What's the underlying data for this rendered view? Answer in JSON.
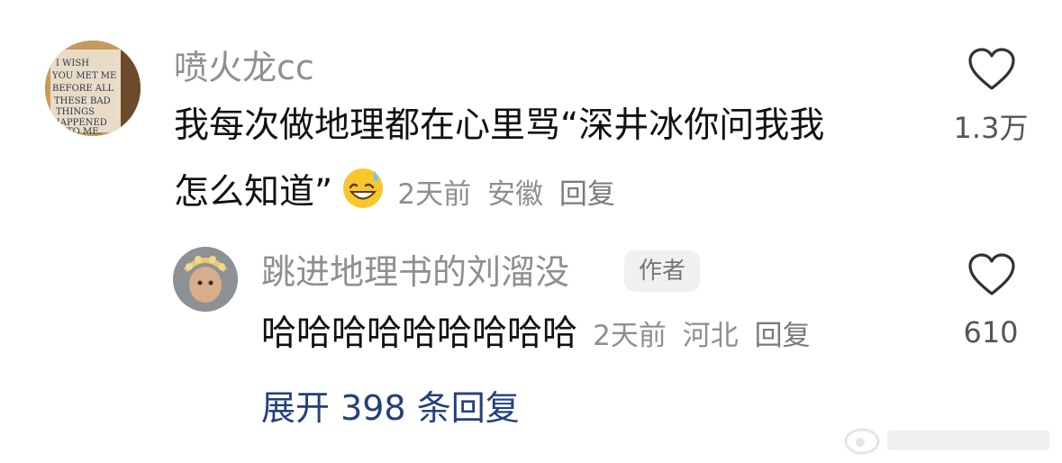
{
  "comment": {
    "username": "喷火龙cc",
    "avatar_text": "I WISH YOU MET ME BEFORE ALL THESE BAD THINGS HAPPENED TO ME.",
    "text_line1": "我每次做地理都在心里骂“深井冰你问我我",
    "text_line2": "怎么知道”",
    "emoji": "sweat-smile-emoji",
    "time": "2天前",
    "location": "安徽",
    "reply_label": "回复",
    "like_count": "1.3万"
  },
  "reply": {
    "username": "跳进地理书的刘溜没",
    "badge": "作者",
    "text": "哈哈哈哈哈哈哈哈哈",
    "time": "2天前",
    "location": "河北",
    "reply_label": "回复",
    "like_count": "610"
  },
  "expand_label": "展开 398 条回复",
  "watermark_icon": "weibo-watermark-icon"
}
